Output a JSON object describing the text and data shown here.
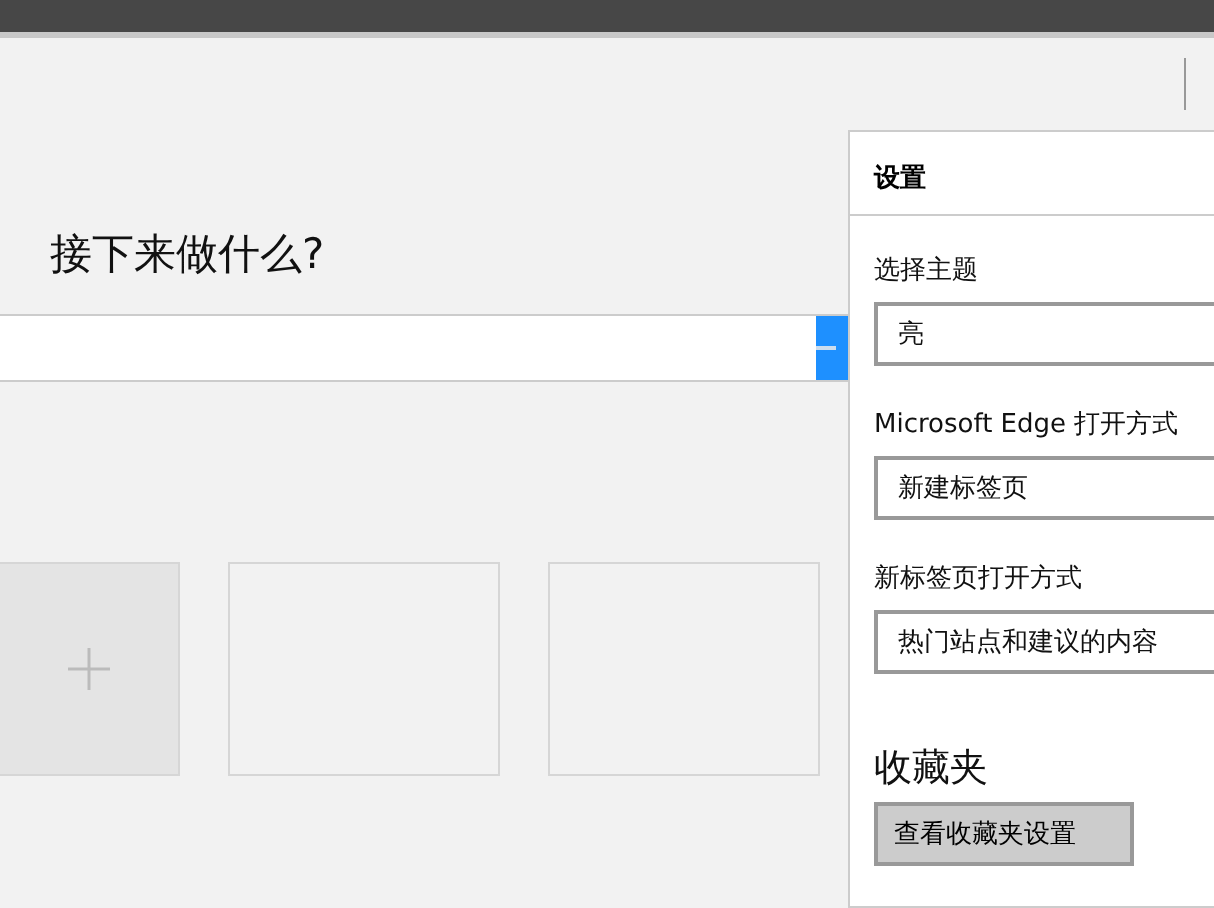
{
  "new_tab": {
    "heading": "接下来做什么?",
    "tiles": [
      {
        "kind": "add"
      },
      {
        "kind": "empty"
      },
      {
        "kind": "empty"
      }
    ]
  },
  "settings": {
    "title": "设置",
    "fields": [
      {
        "label": "选择主题",
        "value": "亮"
      },
      {
        "label": "Microsoft Edge 打开方式",
        "value": "新建标签页"
      },
      {
        "label": "新标签页打开方式",
        "value": "热门站点和建议的内容"
      }
    ],
    "favorites": {
      "heading": "收藏夹",
      "button": "查看收藏夹设置"
    }
  }
}
